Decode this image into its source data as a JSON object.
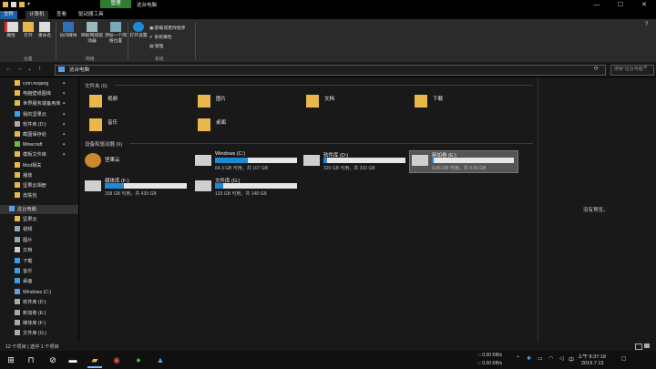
{
  "window": {
    "context_tab": "管理",
    "title": "这台电脑",
    "controls": {
      "minimize": "—",
      "maximize": "☐",
      "close": "✕"
    }
  },
  "ribbon_tabs": [
    "文件",
    "计算机",
    "查看",
    "驱动器工具"
  ],
  "ribbon": {
    "location": {
      "group": "位置",
      "buttons": [
        "属性",
        "打开",
        "重命名"
      ]
    },
    "network": {
      "group": "网络",
      "buttons": [
        "访问媒体",
        "映射网络驱动器",
        "添加一个网络位置"
      ]
    },
    "system": {
      "group": "系统",
      "open_settings": "打开设置",
      "items": [
        "卸载或更改程序",
        "系统属性",
        "管理"
      ]
    }
  },
  "address": {
    "back": "←",
    "forward": "→",
    "recent": "⌄",
    "up": "↑",
    "path": "这台电脑",
    "search_placeholder": "搜索\"这台电脑\""
  },
  "sidebar": {
    "quick_access": [
      {
        "label": "com.mojang",
        "pinned": true
      },
      {
        "label": "电脑壁纸图库",
        "pinned": true
      },
      {
        "label": "世界服务端备用库",
        "pinned": true
      },
      {
        "label": "我的坚果云",
        "pinned": true
      },
      {
        "label": "软件库 (D:)",
        "pinned": true
      },
      {
        "label": "截图保存处",
        "pinned": true
      },
      {
        "label": "Minecraft",
        "pinned": true
      },
      {
        "label": "模板文件库",
        "pinned": true
      },
      {
        "label": "Mod相关",
        "pinned": false
      },
      {
        "label": "播放",
        "pinned": false
      },
      {
        "label": "坚果云相册",
        "pinned": false
      },
      {
        "label": "皮肤包",
        "pinned": false
      }
    ],
    "this_pc_label": "这台电脑",
    "this_pc": [
      "坚果云",
      "视频",
      "图片",
      "文档",
      "下载",
      "音乐",
      "桌面",
      "Windows (C:)",
      "软件库 (D:)",
      "新加卷 (E:)",
      "媒体库 (F:)",
      "文件库 (G:)"
    ]
  },
  "main": {
    "folders_header": "文件夹 (6)",
    "folders": [
      "视频",
      "图片",
      "文档",
      "下载",
      "音乐",
      "桌面"
    ],
    "devices_header": "设备和驱动器 (6)",
    "drives": [
      {
        "name": "坚果云",
        "free": ""
      },
      {
        "name": "Windows (C:)",
        "free": "64.3 GB 可用，共 107 GB",
        "used_fraction": 0.4
      },
      {
        "name": "软件库 (D:)",
        "free": "320 GB 可用，共 333 GB",
        "used_fraction": 0.04
      },
      {
        "name": "新加卷 (E:)",
        "free": "9.96 GB 可用，共 9.99 GB",
        "used_fraction": 0.01
      },
      {
        "name": "媒体库 (F:)",
        "free": "338 GB 可用，共 439 GB",
        "used_fraction": 0.23
      },
      {
        "name": "文件库 (G:)",
        "free": "133 GB 可用，共 148 GB",
        "used_fraction": 0.1
      }
    ],
    "preview": "没有预览。"
  },
  "status": "12 个项目 | 选中 1 个项目",
  "taskbar": {
    "net_up": "↑: 0.00 KB/s",
    "net_down": "↓: 0.00 KB/s",
    "time": "上午 8:37:18",
    "date": "2019.7.13"
  },
  "colors": {
    "accent": "#1e8ad6",
    "context_tab": "#2e7d32",
    "file_tab": "#1c5fa8"
  }
}
